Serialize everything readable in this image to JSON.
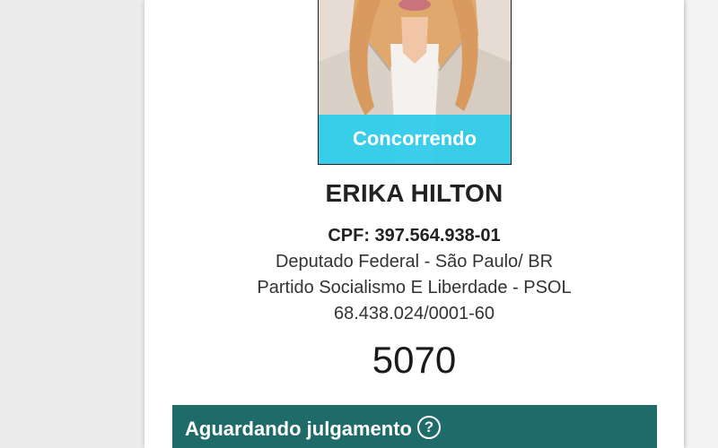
{
  "candidate": {
    "status": "Concorrendo",
    "name": "ERIKA HILTON",
    "cpf": "CPF: 397.564.938-01",
    "office": "Deputado Federal - São Paulo/ BR",
    "party": "Partido Socialismo E Liberdade - PSOL",
    "party_cnpj": "68.438.024/0001-60",
    "number": "5070"
  },
  "judgment": {
    "label": "Aguardando julgamento",
    "help_icon": "question-circle-icon",
    "help_glyph": "?"
  },
  "colors": {
    "status_tag": "#2acce9",
    "judgment_bar": "#1f6b6a",
    "background": "#ececec"
  }
}
